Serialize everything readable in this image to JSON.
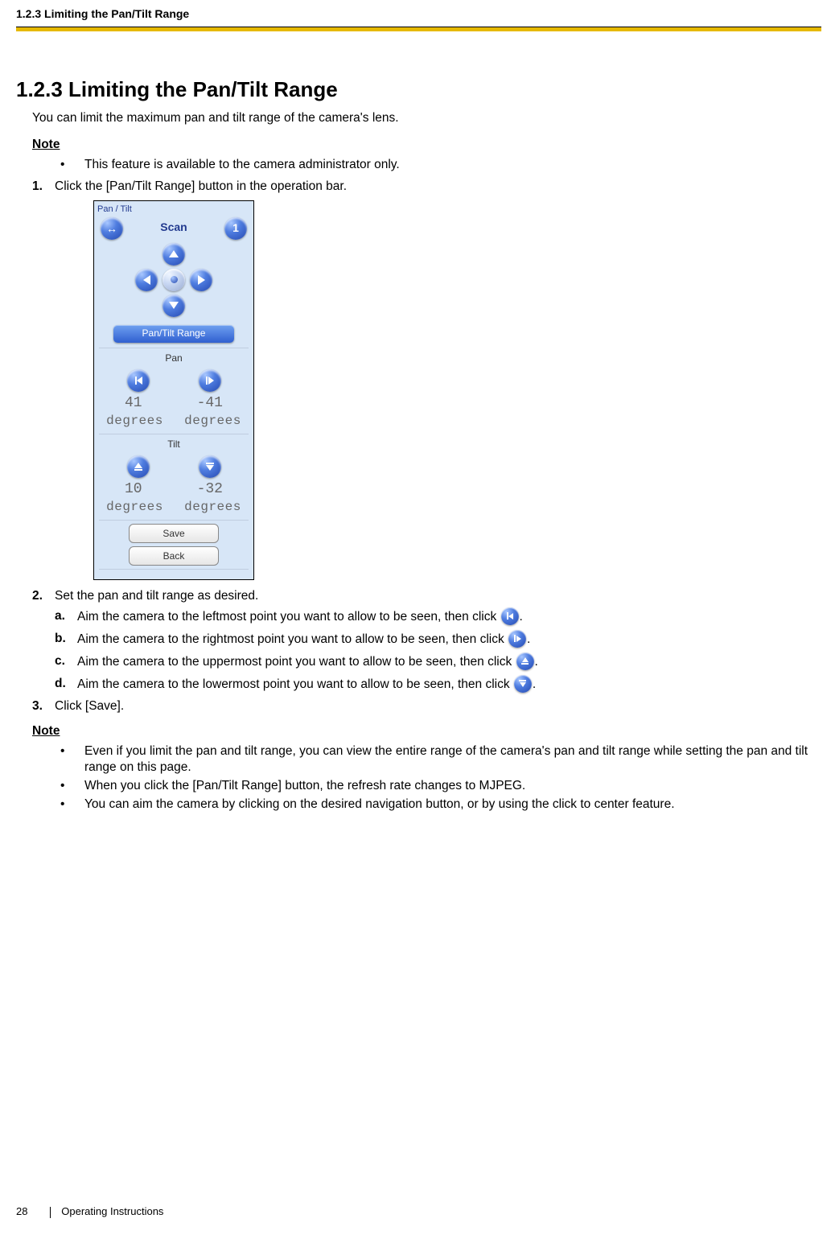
{
  "header": {
    "running_head": "1.2.3 Limiting the Pan/Tilt Range"
  },
  "section": {
    "number_title": "1.2.3  Limiting the Pan/Tilt Range",
    "intro": "You can limit the maximum pan and tilt range of the camera's lens.",
    "note1_label": "Note",
    "note1_bullets": [
      "This feature is available to the camera administrator only."
    ],
    "step1": "Click the [Pan/Tilt Range] button in the operation bar.",
    "step2": "Set the pan and tilt range as desired.",
    "step2_sub": {
      "a_pre": "Aim the camera to the leftmost point you want to allow to be seen, then click ",
      "b_pre": "Aim the camera to the rightmost point you want to allow to be seen, then click ",
      "c_pre": "Aim the camera to the uppermost point you want to allow to be seen, then click ",
      "d_pre": "Aim the camera to the lowermost point you want to allow to be seen, then click ",
      "period": "."
    },
    "step3": "Click [Save].",
    "note2_label": "Note",
    "note2_bullets": [
      "Even if you limit the pan and tilt range, you can view the entire range of the camera's pan and tilt range while setting the pan and tilt range on this page.",
      "When you click the [Pan/Tilt Range] button, the refresh rate changes to MJPEG.",
      "You can aim the camera by clicking on the desired navigation button, or by using the click to center feature."
    ]
  },
  "panel": {
    "title": "Pan / Tilt",
    "scan_label": "Scan",
    "scan_num": "1",
    "range_button": "Pan/Tilt Range",
    "pan_label": "Pan",
    "pan_left_val": "41",
    "pan_right_val": "-41",
    "degrees": "degrees",
    "tilt_label": "Tilt",
    "tilt_up_val": "10",
    "tilt_down_val": "-32",
    "save": "Save",
    "back": "Back"
  },
  "footer": {
    "page": "28",
    "doc": "Operating Instructions"
  }
}
